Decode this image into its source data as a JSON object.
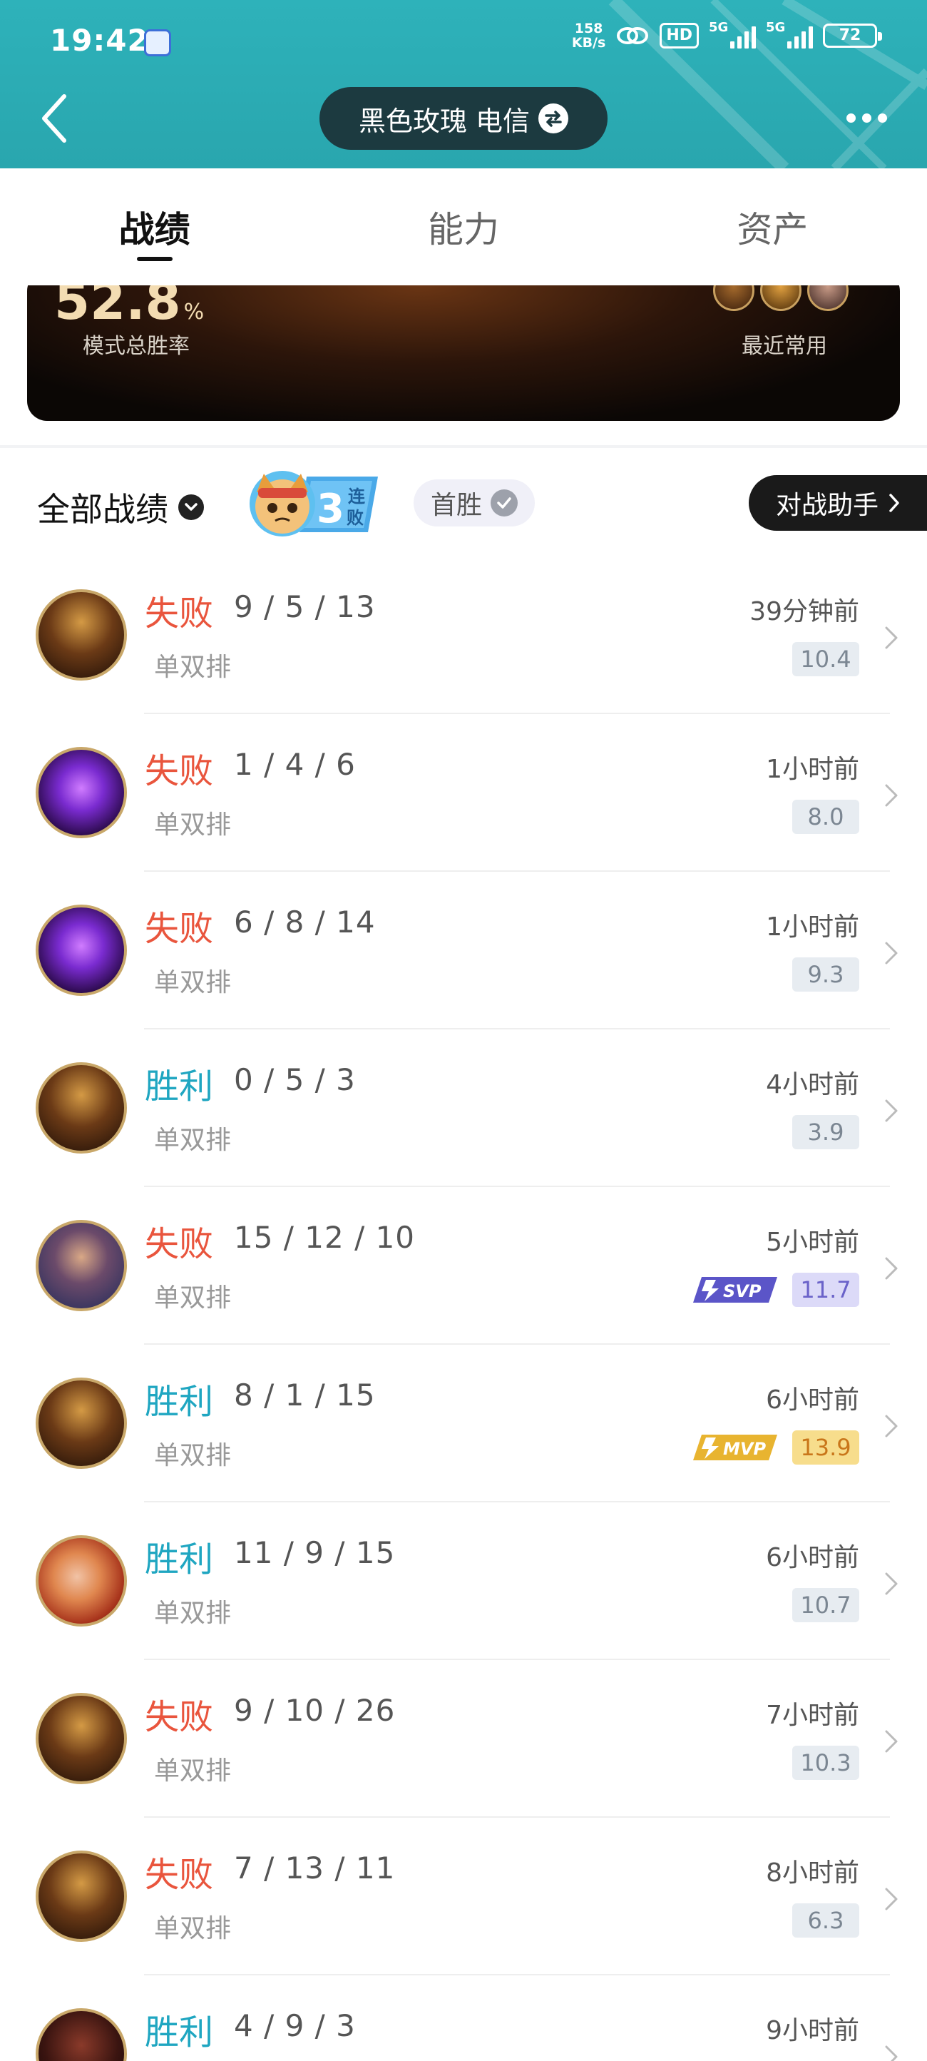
{
  "status_bar": {
    "time": "19:42",
    "net_speed_value": "158",
    "net_speed_unit": "KB/s",
    "hd_label": "HD",
    "sim1_label": "5G",
    "sim2_label": "5G",
    "battery": "72"
  },
  "header": {
    "account_name": "黑色玫瑰 电信",
    "back_icon": "back-arrow-icon",
    "swap_icon": "swap-icon",
    "more_icon": "more-dots-icon"
  },
  "tabs": [
    {
      "label": "战绩",
      "active": true
    },
    {
      "label": "能力",
      "active": false
    },
    {
      "label": "资产",
      "active": false
    }
  ],
  "summary": {
    "win_rate": "52.8",
    "win_rate_unit": "%",
    "win_rate_label": "模式总胜率",
    "recent_label": "最近常用"
  },
  "filters": {
    "all_label": "全部战绩",
    "streak_number": "3",
    "streak_text_1": "连",
    "streak_text_2": "败",
    "first_win_label": "首胜",
    "assistant_label": "对战助手"
  },
  "matches": [
    {
      "result": "失败",
      "outcome": "loss",
      "kda": "9 / 5 / 13",
      "mode": "单双排",
      "time": "39分钟前",
      "score": "10.4",
      "badge": "",
      "hero": "gold"
    },
    {
      "result": "失败",
      "outcome": "loss",
      "kda": "1 / 4 / 6",
      "mode": "单双排",
      "time": "1小时前",
      "score": "8.0",
      "badge": "",
      "hero": "purple"
    },
    {
      "result": "失败",
      "outcome": "loss",
      "kda": "6 / 8 / 14",
      "mode": "单双排",
      "time": "1小时前",
      "score": "9.3",
      "badge": "",
      "hero": "purple"
    },
    {
      "result": "胜利",
      "outcome": "win",
      "kda": "0 / 5 / 3",
      "mode": "单双排",
      "time": "4小时前",
      "score": "3.9",
      "badge": "",
      "hero": "gold"
    },
    {
      "result": "失败",
      "outcome": "loss",
      "kda": "15 / 12 / 10",
      "mode": "单双排",
      "time": "5小时前",
      "score": "11.7",
      "badge": "SVP",
      "hero": "blue"
    },
    {
      "result": "胜利",
      "outcome": "win",
      "kda": "8 / 1 / 15",
      "mode": "单双排",
      "time": "6小时前",
      "score": "13.9",
      "badge": "MVP",
      "hero": "gold"
    },
    {
      "result": "胜利",
      "outcome": "win",
      "kda": "11 / 9 / 15",
      "mode": "单双排",
      "time": "6小时前",
      "score": "10.7",
      "badge": "",
      "hero": "red"
    },
    {
      "result": "失败",
      "outcome": "loss",
      "kda": "9 / 10 / 26",
      "mode": "单双排",
      "time": "7小时前",
      "score": "10.3",
      "badge": "",
      "hero": "gold"
    },
    {
      "result": "失败",
      "outcome": "loss",
      "kda": "7 / 13 / 11",
      "mode": "单双排",
      "time": "8小时前",
      "score": "6.3",
      "badge": "",
      "hero": "gold"
    },
    {
      "result": "胜利",
      "outcome": "win",
      "kda": "4 / 9 / 3",
      "mode": "",
      "time": "9小时前",
      "score": "",
      "badge": "",
      "hero": "dark"
    }
  ],
  "colors": {
    "header_teal": "#2eb2ba",
    "loss_red": "#e9553d",
    "win_blue": "#1fa6c1",
    "mvp_gold": "#f7dd8c",
    "svp_purple": "#dcdaf8"
  }
}
